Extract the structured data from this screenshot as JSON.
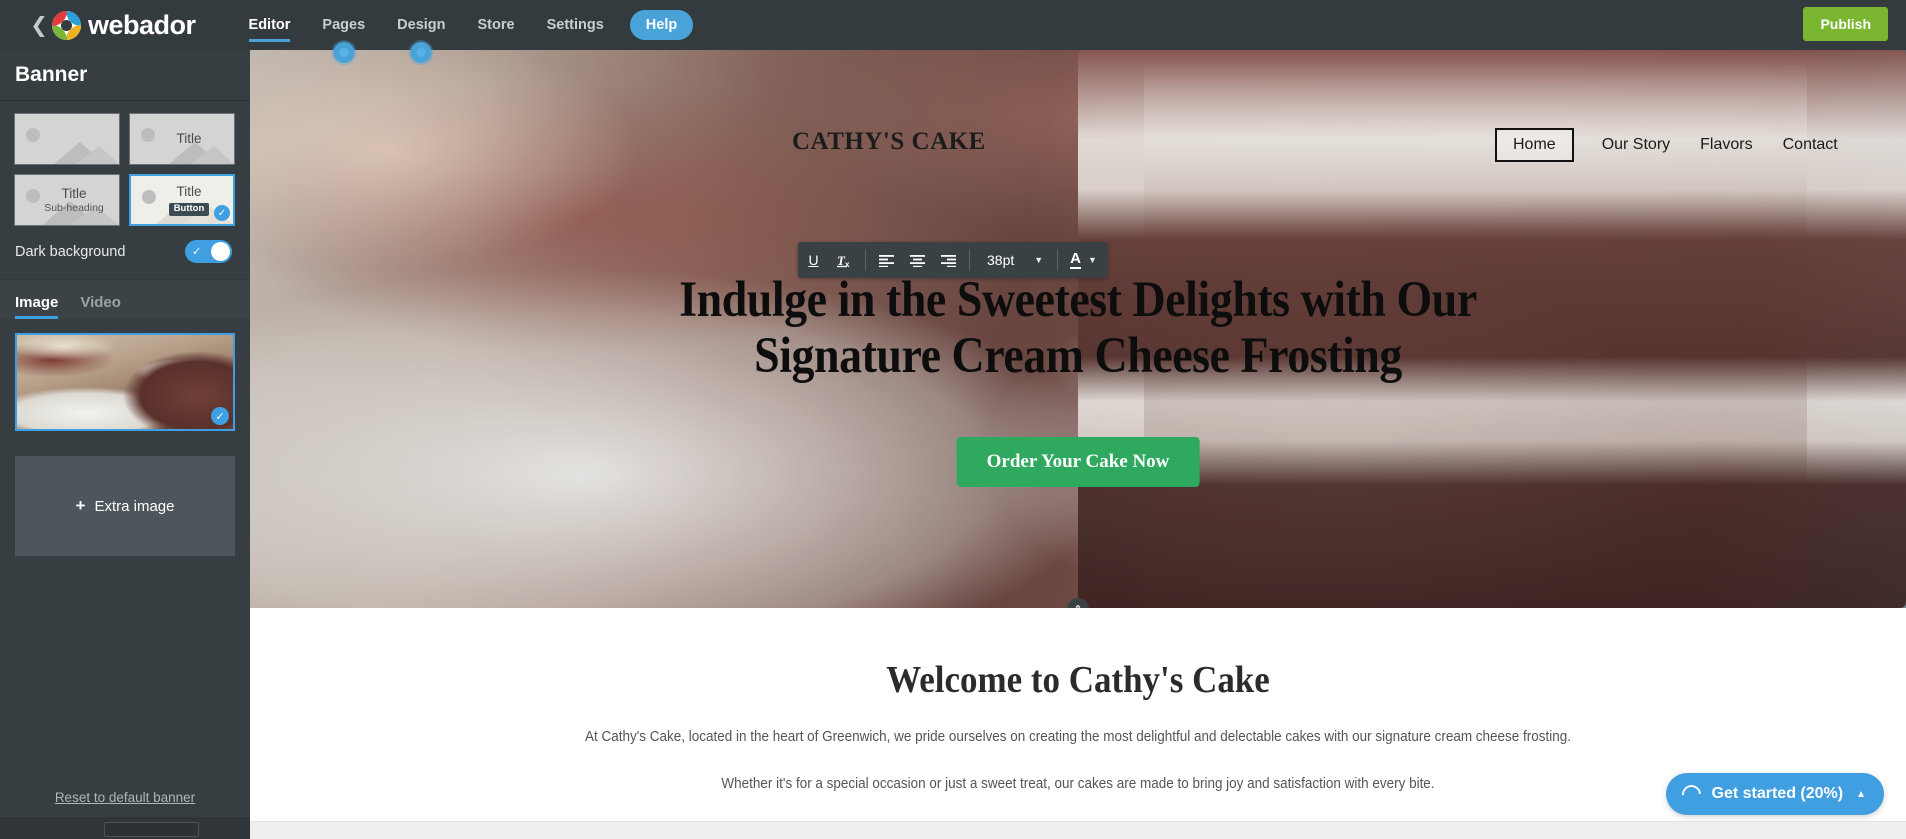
{
  "app": {
    "brand": "webador",
    "back_icon": "chevron-left-icon",
    "logo_icon": "webador-logo-icon"
  },
  "topnav": {
    "items": [
      {
        "label": "Editor",
        "active": true,
        "dot": false
      },
      {
        "label": "Pages",
        "active": false,
        "dot": true
      },
      {
        "label": "Design",
        "active": false,
        "dot": true
      },
      {
        "label": "Store",
        "active": false,
        "dot": false
      },
      {
        "label": "Settings",
        "active": false,
        "dot": false
      }
    ],
    "help_label": "Help",
    "publish_label": "Publish",
    "publish_color": "#7ab630",
    "accent_color": "#3f9fe0"
  },
  "sidebar": {
    "panel_title": "Banner",
    "layouts": [
      {
        "name": "layout-image-only",
        "title": "",
        "sub": "",
        "button": "",
        "selected": false
      },
      {
        "name": "layout-title",
        "title": "Title",
        "sub": "",
        "button": "",
        "selected": false
      },
      {
        "name": "layout-title-subheading",
        "title": "Title",
        "sub": "Sub-heading",
        "button": "",
        "selected": false
      },
      {
        "name": "layout-title-button",
        "title": "Title",
        "sub": "",
        "button": "Button",
        "selected": true
      }
    ],
    "dark_background": {
      "label": "Dark background",
      "value": "on"
    },
    "media_tabs": [
      {
        "label": "Image",
        "active": true
      },
      {
        "label": "Video",
        "active": false
      }
    ],
    "thumbnail": {
      "name": "banner-image-thumbnail",
      "selected": true,
      "check_icon": "check-icon"
    },
    "extra_image_label": "Extra image",
    "extra_image_icon": "plus-icon",
    "reset_link": "Reset to default banner"
  },
  "toolbar": {
    "underline_icon": "underline-icon",
    "underline_label": "U",
    "clear_format_icon": "clear-formatting-icon",
    "clear_format_label": "Tx",
    "align_left_icon": "align-left-icon",
    "align_center_icon": "align-center-icon",
    "align_right_icon": "align-right-icon",
    "font_size": "38pt",
    "size_caret_icon": "chevron-down-icon",
    "text_color_icon": "text-color-icon",
    "text_color_label": "A",
    "color_caret_icon": "chevron-down-icon"
  },
  "site": {
    "logo": "CATHY'S CAKE",
    "nav": [
      {
        "label": "Home",
        "current": true
      },
      {
        "label": "Our Story",
        "current": false
      },
      {
        "label": "Flavors",
        "current": false
      },
      {
        "label": "Contact",
        "current": false
      }
    ],
    "headline_line1": "Indulge in the Sweetest Delights with Our",
    "headline_line2": "Signature Cream Cheese Frosting",
    "cta_label": "Order Your Cake Now",
    "cta_color": "#2ea95f",
    "resize_handle_icon": "resize-vertical-icon",
    "welcome_title": "Welcome to Cathy's Cake",
    "welcome_p1": "At Cathy's Cake, located in the heart of Greenwich, we pride ourselves on creating the most delightful and delectable cakes with our signature cream cheese frosting.",
    "welcome_p2": "Whether it's for a special occasion or just a sweet treat, our cakes are made to bring joy and satisfaction with every bite."
  },
  "get_started": {
    "label": "Get started (20%)",
    "progress": 20,
    "progress_icon": "progress-ring-icon",
    "caret_icon": "chevron-up-icon",
    "color": "#3f9fe0"
  }
}
